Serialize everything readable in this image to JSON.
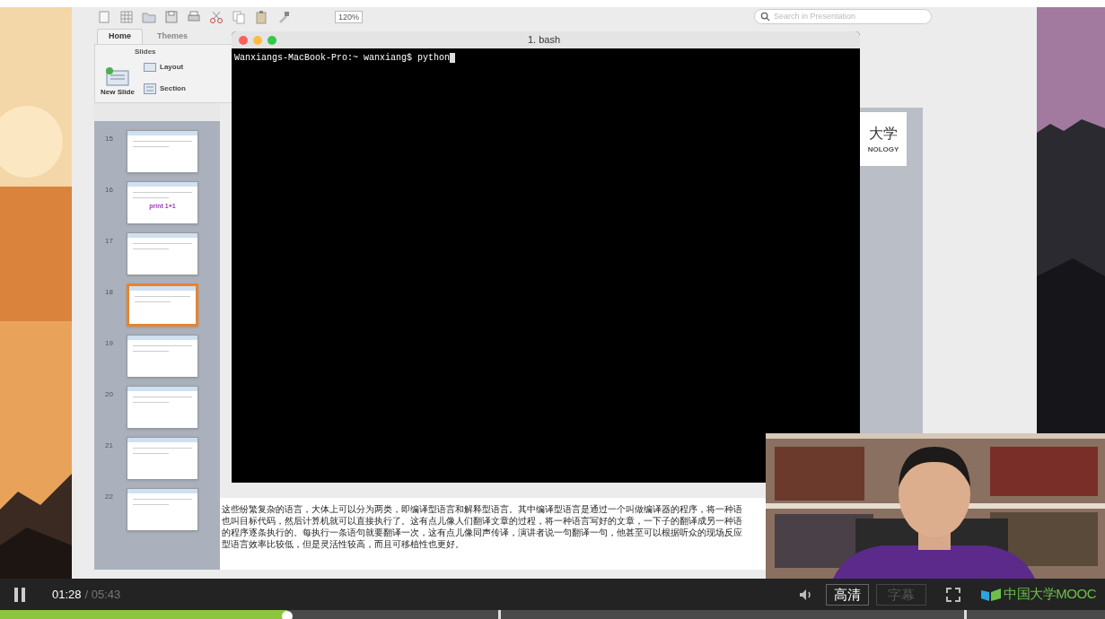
{
  "presentation_window": {
    "toolbar": {
      "zoom": "120%",
      "search_placeholder": "Search in Presentation"
    },
    "ribbon_tabs": [
      {
        "label": "Home",
        "selected": true
      },
      {
        "label": "Themes",
        "selected": false
      }
    ],
    "ribbon_group": "Slides",
    "ribbon_buttons": [
      "New Slide",
      "Layout",
      "Section"
    ],
    "slides": [
      {
        "number": "15",
        "selected": false
      },
      {
        "number": "16",
        "selected": false,
        "text": "print 1+1"
      },
      {
        "number": "17",
        "selected": false
      },
      {
        "number": "18",
        "selected": true
      },
      {
        "number": "19",
        "selected": false
      },
      {
        "number": "20",
        "selected": false
      },
      {
        "number": "21",
        "selected": false
      },
      {
        "number": "22",
        "selected": false
      }
    ],
    "slide_logo": "大学",
    "slide_logo_sub": "NOLOGY",
    "notes": [
      "这些纷繁复杂的语言，大体上可以分为两类，即编译型语言和解释型语言。其中编译型语言是通过一个叫做编译器的程序，将一种语",
      "也叫目标代码，然后计算机就可以直接执行了。这有点儿像人们翻译文章的过程，将一种语言写好的文章，一下子的翻译成另一种语",
      "的程序逐条执行的。每执行一条语句就要翻译一次，这有点儿像同声传译，演讲者说一句翻译一句，他甚至可以根据听众的现场反应",
      "型语言效率比较低，但是灵活性较高，而且可移植性也更好。"
    ]
  },
  "terminal": {
    "title": "1. bash",
    "prompt": "Wanxiangs-MacBook-Pro:~ wanxiang$ python"
  },
  "player": {
    "playing": true,
    "current_time": "01:28",
    "duration": "/ 05:43",
    "progress": {
      "level": 0.26
    },
    "quality_button": "高清",
    "subtitle_button": {
      "label": "字幕",
      "disabled": true
    },
    "logo": "中国大学MOOC"
  }
}
